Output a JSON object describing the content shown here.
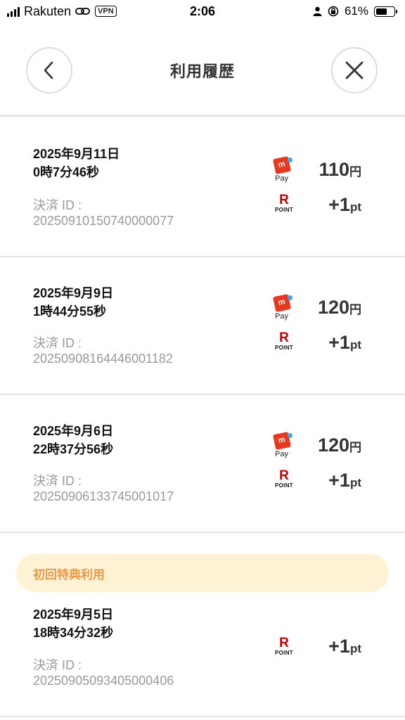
{
  "status_bar": {
    "carrier": "Rakuten",
    "vpn": "VPN",
    "time": "2:06",
    "battery": "61%",
    "battery_level": 0.61
  },
  "header": {
    "title": "利用履歴",
    "back_icon": "chevron-left-icon",
    "close_icon": "close-icon"
  },
  "labels": {
    "id_label": "決済 ID :"
  },
  "transactions": [
    {
      "date": "2025年9月11日",
      "time": "0時7分46秒",
      "payment_id": "20250910150740000077",
      "amount": "110",
      "amount_unit": "円",
      "points": "+1",
      "points_unit": "pt"
    },
    {
      "date": "2025年9月9日",
      "time": "1時44分55秒",
      "payment_id": "20250908164446001182",
      "amount": "120",
      "amount_unit": "円",
      "points": "+1",
      "points_unit": "pt"
    },
    {
      "date": "2025年9月6日",
      "time": "22時37分56秒",
      "payment_id": "20250906133745001017",
      "amount": "120",
      "amount_unit": "円",
      "points": "+1",
      "points_unit": "pt"
    },
    {
      "promo": "初回特典利用",
      "date": "2025年9月5日",
      "time": "18時34分32秒",
      "payment_id": "20250905093405000406",
      "points": "+1",
      "points_unit": "pt"
    }
  ],
  "icons": {
    "merpay": "m",
    "merpay_caption": "Pay",
    "rpoint": "R",
    "rpoint_caption": "POINT"
  },
  "colors": {
    "rakuten_red": "#bf0000",
    "merpay_red": "#e6391f",
    "promo_bg": "#fdf2d3",
    "promo_text": "#e89a4a"
  }
}
